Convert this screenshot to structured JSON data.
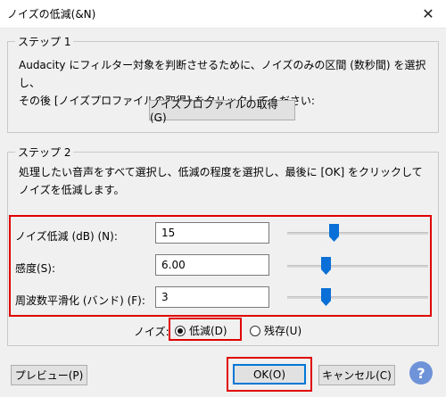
{
  "window": {
    "title": "ノイズの低減(&N)",
    "close_glyph": "✕"
  },
  "step1": {
    "legend": "ステップ 1",
    "line1": "Audacity にフィルター対象を判断させるために、ノイズのみの区間 (数秒間) を選択し、",
    "line2": "その後 [ノイズプロファイルの取得] をクリックしてください:",
    "button": "ノイズプロファイルの取得(G)"
  },
  "step2": {
    "legend": "ステップ 2",
    "line1": "処理したい音声をすべて選択し、低減の程度を選択し、最後に [OK] をクリックして",
    "line2": "ノイズを低減します。"
  },
  "params": [
    {
      "label": "ノイズ低減 (dB) (N):",
      "value": "15",
      "slider_fraction": 0.33
    },
    {
      "label": "感度(S):",
      "value": "6.00",
      "slider_fraction": 0.27
    },
    {
      "label": "周波数平滑化 (バンド) (F):",
      "value": "3",
      "slider_fraction": 0.27
    }
  ],
  "noise": {
    "label": "ノイズ:",
    "options": [
      {
        "label": "低減(D)",
        "selected": true
      },
      {
        "label": "残存(U)",
        "selected": false
      }
    ]
  },
  "buttons": {
    "preview": "プレビュー(P)",
    "ok": "OK(O)",
    "cancel": "キャンセル(C)",
    "help": "?"
  },
  "colors": {
    "highlight": "#e00000",
    "default_button_border": "#0078d7",
    "slider_thumb": "#0a6fd6",
    "help_button": "#6f93d8"
  },
  "icons": {
    "close": "close-icon",
    "help": "help-icon",
    "slider_thumb": "slider-thumb-icon"
  }
}
